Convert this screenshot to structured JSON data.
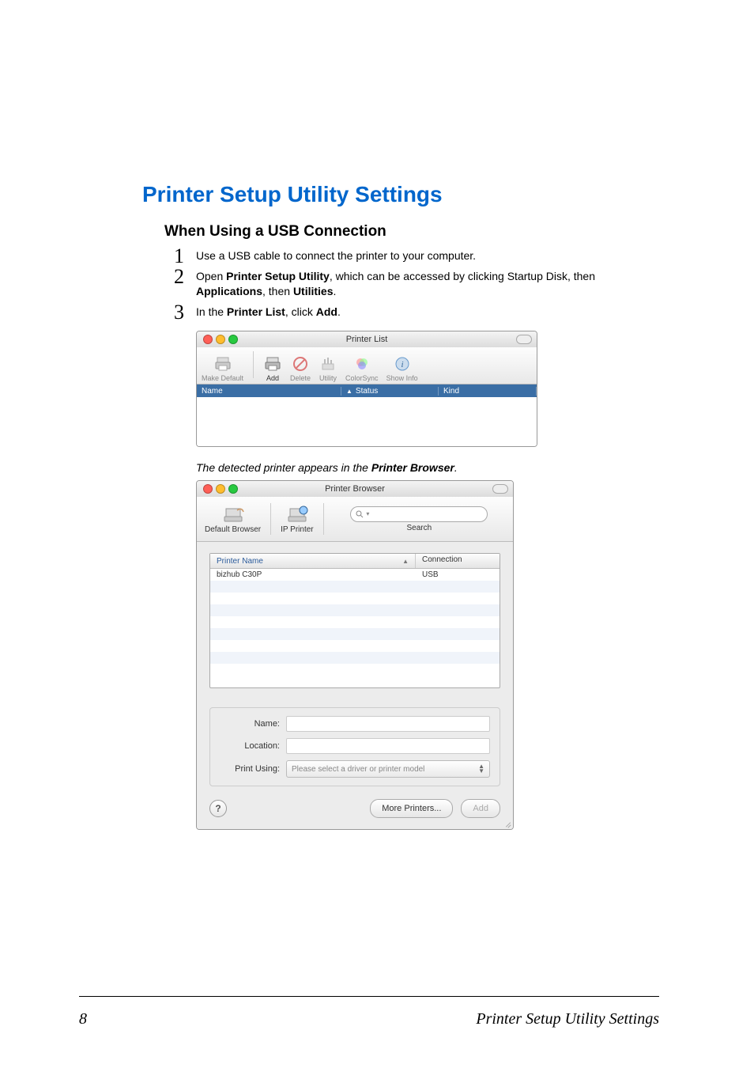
{
  "heading": "Printer Setup Utility Settings",
  "subheading": "When Using a USB Connection",
  "steps": [
    {
      "n": "1",
      "pre": "Use a USB cable to connect the printer to your computer."
    },
    {
      "n": "2",
      "parts": [
        "Open ",
        "Printer Setup Utility",
        ", which can be accessed by clicking Startup Disk, then ",
        "Applications",
        ", then ",
        "Utilities",
        "."
      ]
    },
    {
      "n": "3",
      "parts": [
        "In the ",
        "Printer List",
        ", click ",
        "Add",
        "."
      ]
    }
  ],
  "printer_list": {
    "title": "Printer List",
    "toolbar": {
      "make_default": "Make Default",
      "add": "Add",
      "delete": "Delete",
      "utility": "Utility",
      "colorsync": "ColorSync",
      "show_info": "Show Info"
    },
    "columns": {
      "name": "Name",
      "status": "Status",
      "kind": "Kind"
    }
  },
  "caption_parts": [
    "The detected printer appears in the ",
    "Printer Browser",
    "."
  ],
  "printer_browser": {
    "title": "Printer Browser",
    "tabs": {
      "default": "Default Browser",
      "ip": "IP Printer",
      "search": "Search"
    },
    "search_placeholder": "",
    "table": {
      "col1": "Printer Name",
      "col2": "Connection",
      "row_name": "bizhub C30P",
      "row_conn": "USB"
    },
    "form": {
      "name": "Name:",
      "location": "Location:",
      "print_using": "Print Using:",
      "select_placeholder": "Please select a driver or printer model"
    },
    "buttons": {
      "more": "More Printers...",
      "add": "Add"
    },
    "help": "?"
  },
  "footer": {
    "page": "8",
    "title": "Printer Setup Utility Settings"
  }
}
